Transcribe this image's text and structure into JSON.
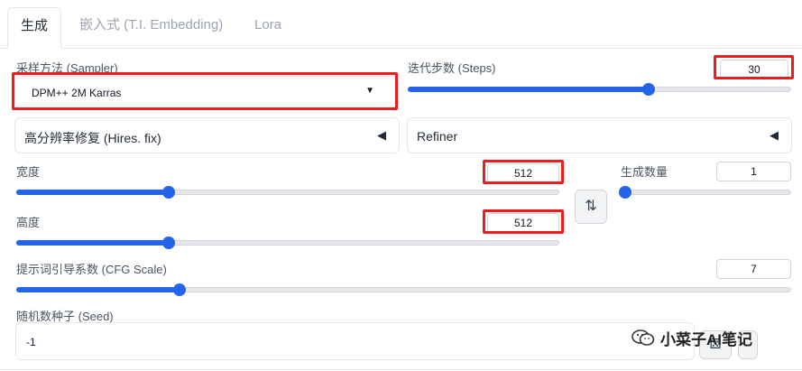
{
  "tabs": [
    {
      "label": "生成",
      "active": true
    },
    {
      "label": "嵌入式 (T.I. Embedding)",
      "active": false
    },
    {
      "label": "Lora",
      "active": false
    }
  ],
  "sampler": {
    "label": "采样方法 (Sampler)",
    "value": "DPM++ 2M Karras"
  },
  "steps": {
    "label": "迭代步数 (Steps)",
    "value": "30",
    "level": 0.63
  },
  "hires": {
    "label": "高分辨率修复 (Hires. fix)"
  },
  "refiner": {
    "label": "Refiner"
  },
  "width": {
    "label": "宽度",
    "value": "512",
    "level": 0.28
  },
  "height": {
    "label": "高度",
    "value": "512",
    "level": 0.28
  },
  "swap_button": {
    "icon": "swap-vertical-icon",
    "glyph": "⇅"
  },
  "batch_count": {
    "label": "生成数量",
    "value": "1",
    "level": 0.0
  },
  "cfg": {
    "label": "提示词引导系数 (CFG Scale)",
    "value": "7",
    "level": 0.21
  },
  "seed": {
    "label": "随机数种子 (Seed)",
    "value": "-1"
  },
  "watermark": {
    "text": "小菜子AI笔记"
  },
  "colors": {
    "accent": "#2563eb",
    "highlight": "#ee1c1c"
  }
}
